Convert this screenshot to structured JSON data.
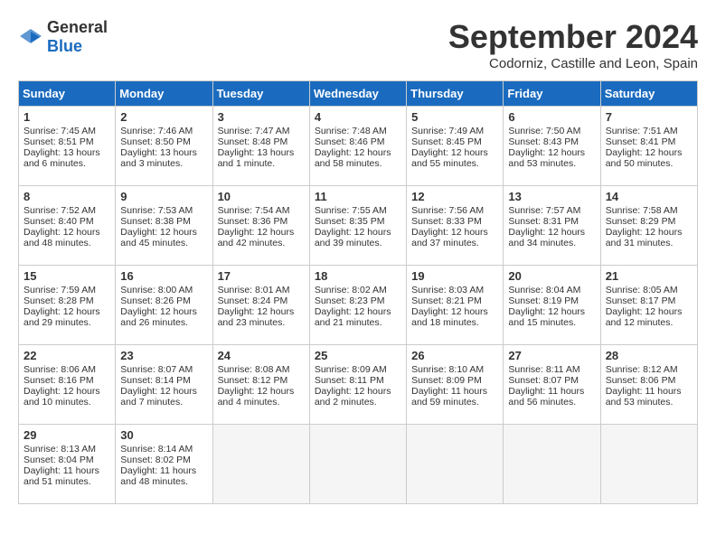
{
  "header": {
    "logo_general": "General",
    "logo_blue": "Blue",
    "month_title": "September 2024",
    "location": "Codorniz, Castille and Leon, Spain"
  },
  "columns": [
    "Sunday",
    "Monday",
    "Tuesday",
    "Wednesday",
    "Thursday",
    "Friday",
    "Saturday"
  ],
  "rows": [
    [
      {
        "day": "1",
        "text": "Sunrise: 7:45 AM\nSunset: 8:51 PM\nDaylight: 13 hours\nand 6 minutes."
      },
      {
        "day": "2",
        "text": "Sunrise: 7:46 AM\nSunset: 8:50 PM\nDaylight: 13 hours\nand 3 minutes."
      },
      {
        "day": "3",
        "text": "Sunrise: 7:47 AM\nSunset: 8:48 PM\nDaylight: 13 hours\nand 1 minute."
      },
      {
        "day": "4",
        "text": "Sunrise: 7:48 AM\nSunset: 8:46 PM\nDaylight: 12 hours\nand 58 minutes."
      },
      {
        "day": "5",
        "text": "Sunrise: 7:49 AM\nSunset: 8:45 PM\nDaylight: 12 hours\nand 55 minutes."
      },
      {
        "day": "6",
        "text": "Sunrise: 7:50 AM\nSunset: 8:43 PM\nDaylight: 12 hours\nand 53 minutes."
      },
      {
        "day": "7",
        "text": "Sunrise: 7:51 AM\nSunset: 8:41 PM\nDaylight: 12 hours\nand 50 minutes."
      }
    ],
    [
      {
        "day": "8",
        "text": "Sunrise: 7:52 AM\nSunset: 8:40 PM\nDaylight: 12 hours\nand 48 minutes."
      },
      {
        "day": "9",
        "text": "Sunrise: 7:53 AM\nSunset: 8:38 PM\nDaylight: 12 hours\nand 45 minutes."
      },
      {
        "day": "10",
        "text": "Sunrise: 7:54 AM\nSunset: 8:36 PM\nDaylight: 12 hours\nand 42 minutes."
      },
      {
        "day": "11",
        "text": "Sunrise: 7:55 AM\nSunset: 8:35 PM\nDaylight: 12 hours\nand 39 minutes."
      },
      {
        "day": "12",
        "text": "Sunrise: 7:56 AM\nSunset: 8:33 PM\nDaylight: 12 hours\nand 37 minutes."
      },
      {
        "day": "13",
        "text": "Sunrise: 7:57 AM\nSunset: 8:31 PM\nDaylight: 12 hours\nand 34 minutes."
      },
      {
        "day": "14",
        "text": "Sunrise: 7:58 AM\nSunset: 8:29 PM\nDaylight: 12 hours\nand 31 minutes."
      }
    ],
    [
      {
        "day": "15",
        "text": "Sunrise: 7:59 AM\nSunset: 8:28 PM\nDaylight: 12 hours\nand 29 minutes."
      },
      {
        "day": "16",
        "text": "Sunrise: 8:00 AM\nSunset: 8:26 PM\nDaylight: 12 hours\nand 26 minutes."
      },
      {
        "day": "17",
        "text": "Sunrise: 8:01 AM\nSunset: 8:24 PM\nDaylight: 12 hours\nand 23 minutes."
      },
      {
        "day": "18",
        "text": "Sunrise: 8:02 AM\nSunset: 8:23 PM\nDaylight: 12 hours\nand 21 minutes."
      },
      {
        "day": "19",
        "text": "Sunrise: 8:03 AM\nSunset: 8:21 PM\nDaylight: 12 hours\nand 18 minutes."
      },
      {
        "day": "20",
        "text": "Sunrise: 8:04 AM\nSunset: 8:19 PM\nDaylight: 12 hours\nand 15 minutes."
      },
      {
        "day": "21",
        "text": "Sunrise: 8:05 AM\nSunset: 8:17 PM\nDaylight: 12 hours\nand 12 minutes."
      }
    ],
    [
      {
        "day": "22",
        "text": "Sunrise: 8:06 AM\nSunset: 8:16 PM\nDaylight: 12 hours\nand 10 minutes."
      },
      {
        "day": "23",
        "text": "Sunrise: 8:07 AM\nSunset: 8:14 PM\nDaylight: 12 hours\nand 7 minutes."
      },
      {
        "day": "24",
        "text": "Sunrise: 8:08 AM\nSunset: 8:12 PM\nDaylight: 12 hours\nand 4 minutes."
      },
      {
        "day": "25",
        "text": "Sunrise: 8:09 AM\nSunset: 8:11 PM\nDaylight: 12 hours\nand 2 minutes."
      },
      {
        "day": "26",
        "text": "Sunrise: 8:10 AM\nSunset: 8:09 PM\nDaylight: 11 hours\nand 59 minutes."
      },
      {
        "day": "27",
        "text": "Sunrise: 8:11 AM\nSunset: 8:07 PM\nDaylight: 11 hours\nand 56 minutes."
      },
      {
        "day": "28",
        "text": "Sunrise: 8:12 AM\nSunset: 8:06 PM\nDaylight: 11 hours\nand 53 minutes."
      }
    ],
    [
      {
        "day": "29",
        "text": "Sunrise: 8:13 AM\nSunset: 8:04 PM\nDaylight: 11 hours\nand 51 minutes."
      },
      {
        "day": "30",
        "text": "Sunrise: 8:14 AM\nSunset: 8:02 PM\nDaylight: 11 hours\nand 48 minutes."
      },
      null,
      null,
      null,
      null,
      null
    ]
  ]
}
